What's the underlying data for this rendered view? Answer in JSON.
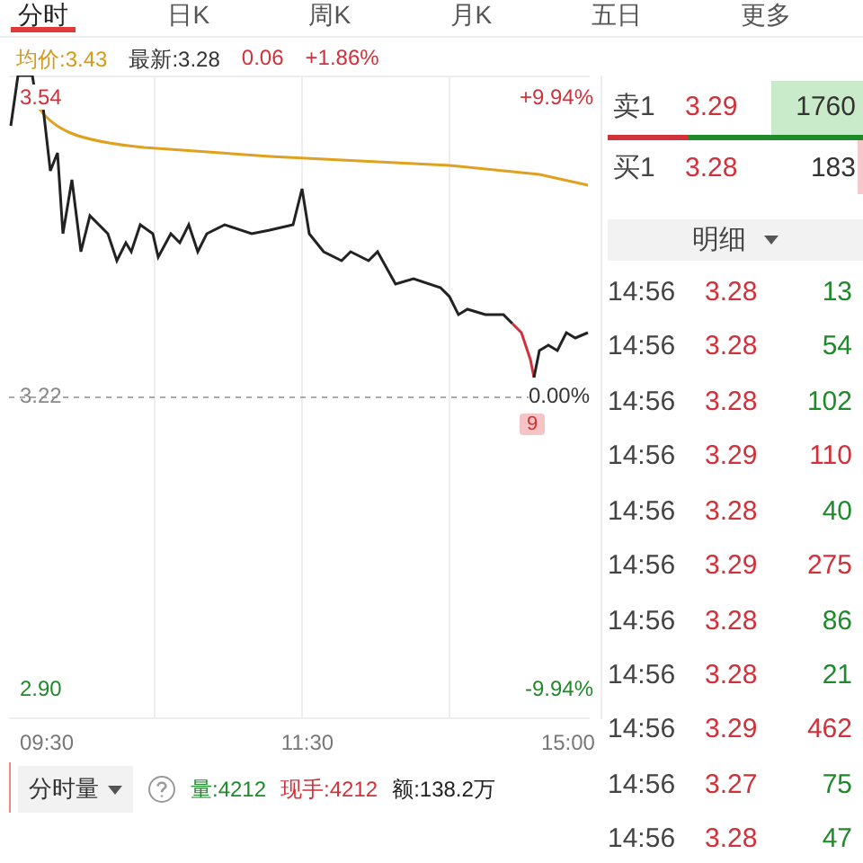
{
  "tabs": [
    {
      "label": "分时",
      "selected": true
    },
    {
      "label": "日K",
      "selected": false
    },
    {
      "label": "周K",
      "selected": false
    },
    {
      "label": "月K",
      "selected": false
    },
    {
      "label": "五日",
      "selected": false
    },
    {
      "label": "更多",
      "selected": false
    }
  ],
  "info": {
    "avg": "均价:3.43",
    "latest": "最新:3.28",
    "change": "0.06",
    "change_pct": "+1.86%"
  },
  "chart": {
    "high": "3.54",
    "high_pct": "+9.94%",
    "mid": "3.22",
    "mid_pct": "0.00%",
    "low": "2.90",
    "low_pct": "-9.94%",
    "marker": "9",
    "times": [
      "09:30",
      "11:30",
      "15:00"
    ]
  },
  "volume_bar": {
    "dropdown": "分时量",
    "volume": "量:4212",
    "current": "现手:4212",
    "amount": "额:138.2万"
  },
  "order_book": [
    {
      "label": "卖1",
      "price": "3.29",
      "volume": "1760",
      "kind": "sell"
    },
    {
      "label": "买1",
      "price": "3.28",
      "volume": "183",
      "kind": "buy"
    }
  ],
  "order_ratio": {
    "level": 0.32
  },
  "details": {
    "title": "明细",
    "rows": [
      {
        "time": "14:56",
        "price": "3.28",
        "volume": "13",
        "color": "#1e8a2a"
      },
      {
        "time": "14:56",
        "price": "3.28",
        "volume": "54",
        "color": "#1e8a2a"
      },
      {
        "time": "14:56",
        "price": "3.28",
        "volume": "102",
        "color": "#1e8a2a"
      },
      {
        "time": "14:56",
        "price": "3.29",
        "volume": "110",
        "color": "#d0313a"
      },
      {
        "time": "14:56",
        "price": "3.28",
        "volume": "40",
        "color": "#1e8a2a"
      },
      {
        "time": "14:56",
        "price": "3.29",
        "volume": "275",
        "color": "#d0313a"
      },
      {
        "time": "14:56",
        "price": "3.28",
        "volume": "86",
        "color": "#1e8a2a"
      },
      {
        "time": "14:56",
        "price": "3.28",
        "volume": "21",
        "color": "#1e8a2a"
      },
      {
        "time": "14:56",
        "price": "3.29",
        "volume": "462",
        "color": "#d0313a"
      },
      {
        "time": "14:56",
        "price": "3.27",
        "volume": "75",
        "color": "#1e8a2a"
      },
      {
        "time": "14:56",
        "price": "3.28",
        "volume": "47",
        "color": "#1e8a2a"
      }
    ]
  }
}
